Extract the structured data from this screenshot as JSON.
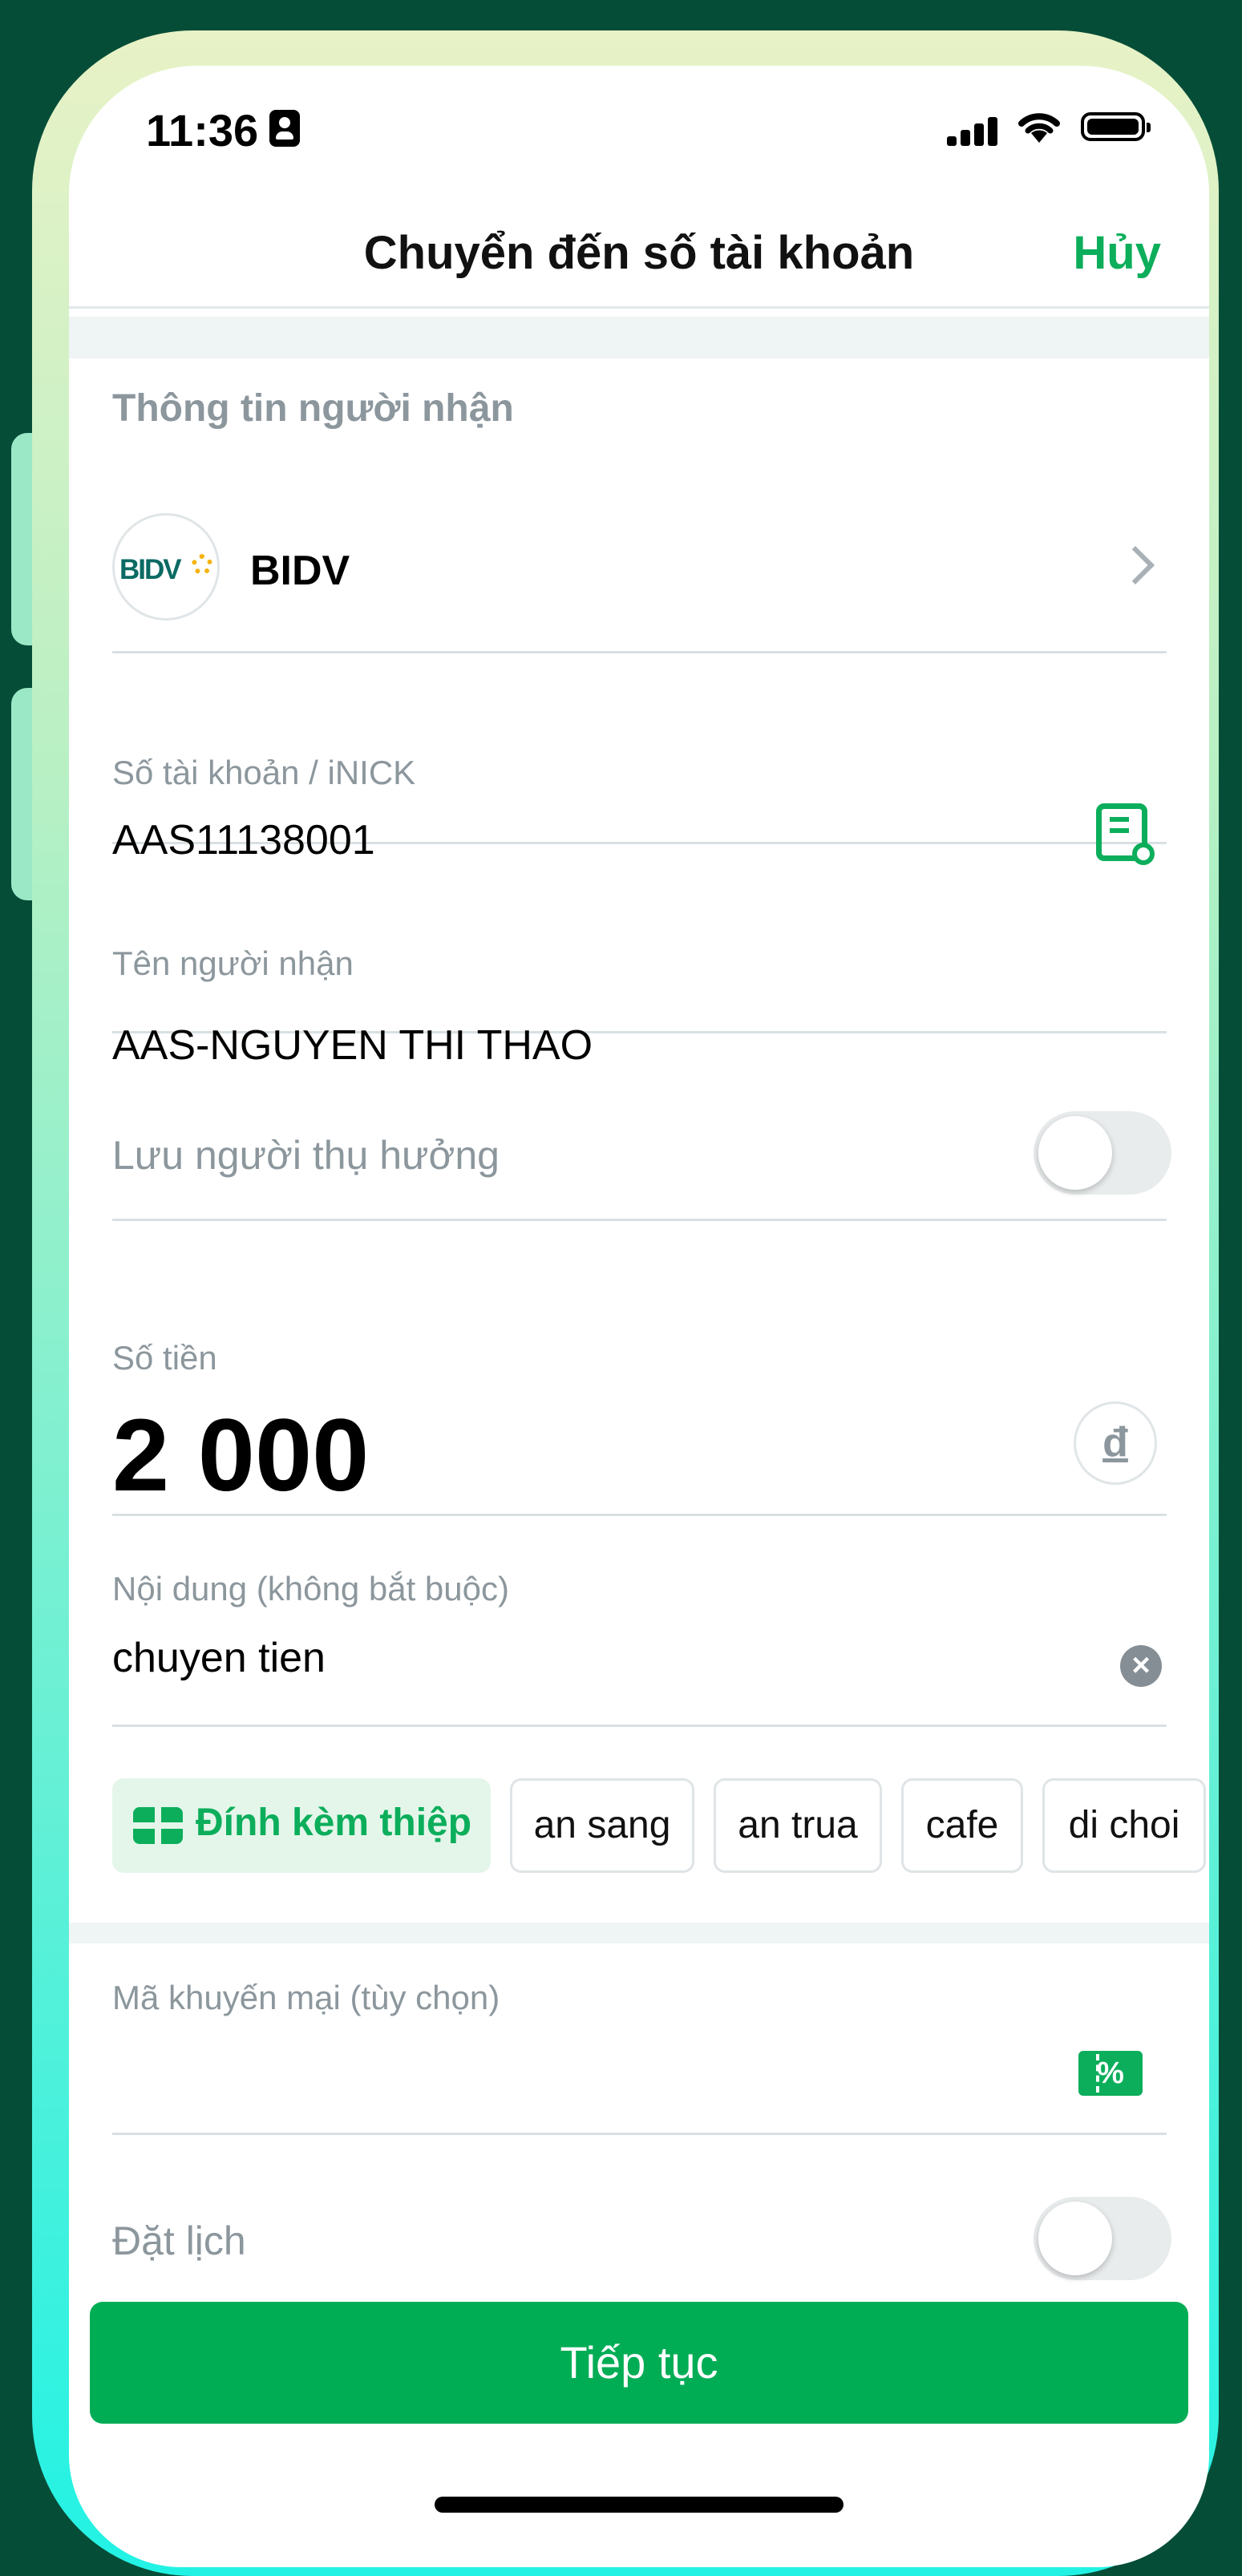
{
  "status_bar": {
    "time": "11:36"
  },
  "header": {
    "title": "Chuyển đến số tài khoản",
    "cancel_label": "Hủy"
  },
  "recipient": {
    "section_title": "Thông tin người nhận",
    "bank": {
      "logo_text": "BIDV",
      "name": "BIDV"
    },
    "account": {
      "label": "Số tài khoản / iNICK",
      "value": "AAS11138001"
    },
    "name": {
      "label": "Tên người nhận",
      "value": "AAS-NGUYEN THI THAO"
    },
    "save_beneficiary": {
      "label": "Lưu người thụ hưởng",
      "on": false
    }
  },
  "amount": {
    "label": "Số tiền",
    "value": "2 000",
    "currency_symbol": "đ"
  },
  "note": {
    "label": "Nội dung (không bắt buộc)",
    "value": "chuyen tien",
    "clear_symbol": "×",
    "chips": {
      "card": "Đính kèm thiệp",
      "items": [
        "an sang",
        "an trua",
        "cafe",
        "di choi"
      ]
    }
  },
  "promo": {
    "label": "Mã khuyến mại (tùy chọn)",
    "icon_symbol": "%"
  },
  "schedule": {
    "label": "Đặt lịch",
    "on": false
  },
  "actions": {
    "continue_label": "Tiếp tục"
  },
  "colors": {
    "accent": "#0cae5b",
    "button": "#00ad55",
    "muted_text": "#8c979d"
  }
}
